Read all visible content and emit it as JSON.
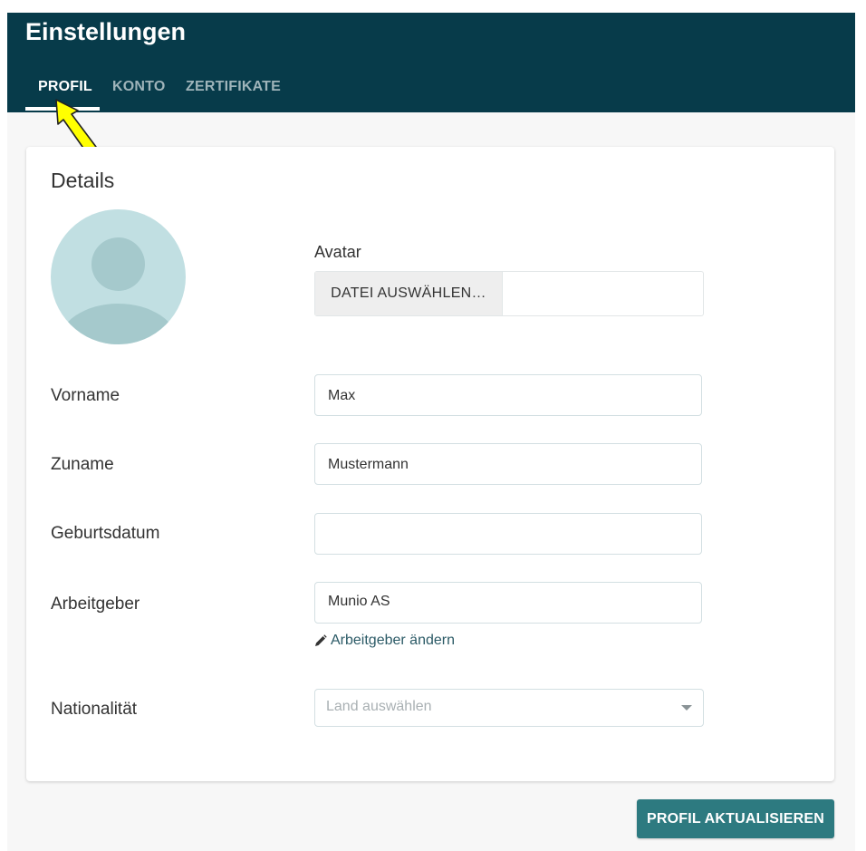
{
  "header": {
    "title": "Einstellungen",
    "tabs": [
      {
        "label": "PROFIL",
        "active": true
      },
      {
        "label": "KONTO",
        "active": false
      },
      {
        "label": "ZERTIFIKATE",
        "active": false
      }
    ]
  },
  "details": {
    "title": "Details",
    "avatar": {
      "label": "Avatar",
      "file_button_label": "DATEI AUSWÄHLEN…"
    },
    "fields": {
      "vorname": {
        "label": "Vorname",
        "value": "Max"
      },
      "zuname": {
        "label": "Zuname",
        "value": "Mustermann"
      },
      "geburtsdatum": {
        "label": "Geburtsdatum",
        "value": ""
      },
      "arbeitgeber": {
        "label": "Arbeitgeber",
        "value": "Munio AS",
        "change_link": "Arbeitgeber ändern"
      },
      "nationalitaet": {
        "label": "Nationalität",
        "placeholder": "Land auswählen"
      }
    }
  },
  "actions": {
    "submit_label": "PROFIL AKTUALISIEREN"
  },
  "colors": {
    "header_bg": "#073b4a",
    "button_bg": "#2d7a80",
    "avatar_bg": "#c1dfe2",
    "arrow_fill": "#ffff00"
  },
  "icons": [
    "pencil-icon",
    "caret-down-icon",
    "arrow-pointer-icon",
    "avatar-placeholder-icon"
  ]
}
